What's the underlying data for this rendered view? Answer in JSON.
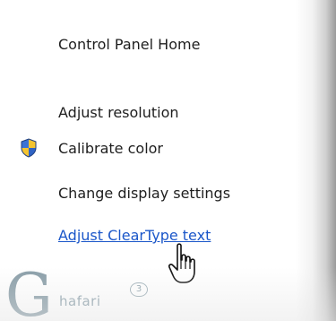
{
  "menu": {
    "items": [
      {
        "label": "Control Panel Home"
      },
      {
        "label": "Adjust resolution"
      },
      {
        "label": "Calibrate color",
        "icon": "uac-shield-icon"
      },
      {
        "label": "Change display settings"
      },
      {
        "label": "Adjust ClearType text",
        "state": "hovered"
      }
    ]
  },
  "watermark": {
    "letter": "G",
    "text": "hafari",
    "badge": "3"
  },
  "colors": {
    "link_hover": "#1a56c9",
    "text": "#1e1e1e"
  }
}
